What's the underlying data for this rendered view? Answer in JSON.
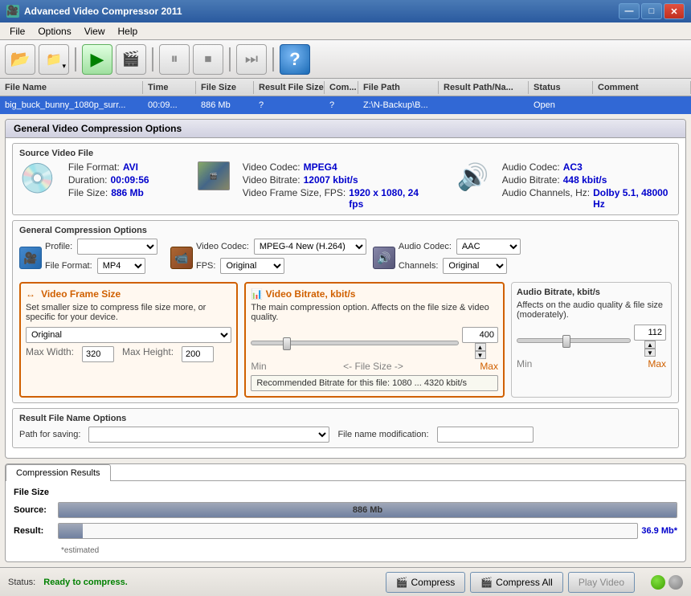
{
  "window": {
    "title": "Advanced Video Compressor 2011",
    "controls": [
      "—",
      "□",
      "✕"
    ]
  },
  "menu": {
    "items": [
      "File",
      "Options",
      "View",
      "Help"
    ]
  },
  "toolbar": {
    "buttons": [
      {
        "name": "open-folder",
        "icon": "📂",
        "label": "Open"
      },
      {
        "name": "folder-dropdown",
        "icon": "📁▾",
        "label": "Folder"
      },
      {
        "name": "play",
        "icon": "▶",
        "label": "Play"
      },
      {
        "name": "compress",
        "icon": "🎬",
        "label": "Compress"
      },
      {
        "name": "pause",
        "icon": "⏸",
        "label": "Pause"
      },
      {
        "name": "stop",
        "icon": "⏹",
        "label": "Stop"
      },
      {
        "name": "skip",
        "icon": "⏭",
        "label": "Skip"
      },
      {
        "name": "help",
        "icon": "?",
        "label": "Help"
      }
    ]
  },
  "file_list": {
    "columns": [
      "File Name",
      "Time",
      "File Size",
      "Result File Size",
      "Com...",
      "File Path",
      "Result Path/Na...",
      "Status",
      "Comment"
    ],
    "rows": [
      {
        "filename": "big_buck_bunny_1080p_surr...",
        "time": "00:09...",
        "filesize": "886 Mb",
        "resultsize": "?",
        "com": "?",
        "filepath": "Z:\\N-Backup\\B...",
        "resultpath": "",
        "status": "Open",
        "comment": ""
      }
    ]
  },
  "general_options": {
    "title": "General Video Compression Options",
    "source_file": {
      "label": "Source Video File",
      "file_format_label": "File Format:",
      "file_format_value": "AVI",
      "duration_label": "Duration:",
      "duration_value": "00:09:56",
      "filesize_label": "File Size:",
      "filesize_value": "886 Mb",
      "video_codec_label": "Video Codec:",
      "video_codec_value": "MPEG4",
      "video_bitrate_label": "Video Bitrate:",
      "video_bitrate_value": "12007 kbit/s",
      "frame_size_label": "Video Frame Size, FPS:",
      "frame_size_value": "1920 x 1080, 24 fps",
      "audio_codec_label": "Audio Codec:",
      "audio_codec_value": "AC3",
      "audio_bitrate_label": "Audio Bitrate:",
      "audio_bitrate_value": "448 kbit/s",
      "audio_channels_label": "Audio Channels, Hz:",
      "audio_channels_value": "Dolby 5.1, 48000 Hz"
    },
    "compression": {
      "label": "General Compression Options",
      "profile_label": "Profile:",
      "profile_value": "",
      "format_label": "File Format:",
      "format_value": "MP4",
      "video_codec_label": "Video Codec:",
      "video_codec_value": "MPEG-4 New (H.264)",
      "fps_label": "FPS:",
      "fps_value": "Original",
      "audio_codec_label": "Audio Codec:",
      "audio_codec_value": "AAC",
      "channels_label": "Channels:",
      "channels_value": "Original"
    },
    "frame_size": {
      "title": "Video Frame Size",
      "description": "Set smaller size to compress file size more, or specific for your device.",
      "preset": "Original",
      "max_width_label": "Max Width:",
      "max_width_value": "320",
      "max_height_label": "Max Height:",
      "max_height_value": "200"
    },
    "video_bitrate": {
      "title": "Video Bitrate, kbit/s",
      "description": "The main compression option. Affects on the file size & video quality.",
      "value": "400",
      "file_size_label": "<- File Size ->",
      "min_label": "Min",
      "max_label": "Max",
      "recommended": "Recommended Bitrate for this file: 1080 ... 4320 kbit/s"
    },
    "audio_bitrate": {
      "title": "Audio Bitrate, kbit/s",
      "description": "Affects on the audio quality & file size (moderately).",
      "value": "112",
      "min_label": "Min",
      "max_label": "Max"
    }
  },
  "result_options": {
    "label": "Result File Name Options",
    "path_label": "Path for saving:",
    "path_value": "",
    "filename_mod_label": "File name modification:",
    "filename_mod_value": ""
  },
  "compression_results": {
    "tab_label": "Compression Results",
    "file_size_label": "File Size",
    "source_label": "Source:",
    "source_value": "886 Mb",
    "result_label": "Result:",
    "result_value": "36.9 Mb*",
    "estimated_label": "*estimated",
    "source_percent": 100,
    "result_percent": 4.2
  },
  "status_bar": {
    "status_label": "Status:",
    "status_value": "Ready to compress.",
    "compress_btn": "Compress",
    "compress_all_btn": "Compress All",
    "play_video_btn": "Play Video"
  }
}
